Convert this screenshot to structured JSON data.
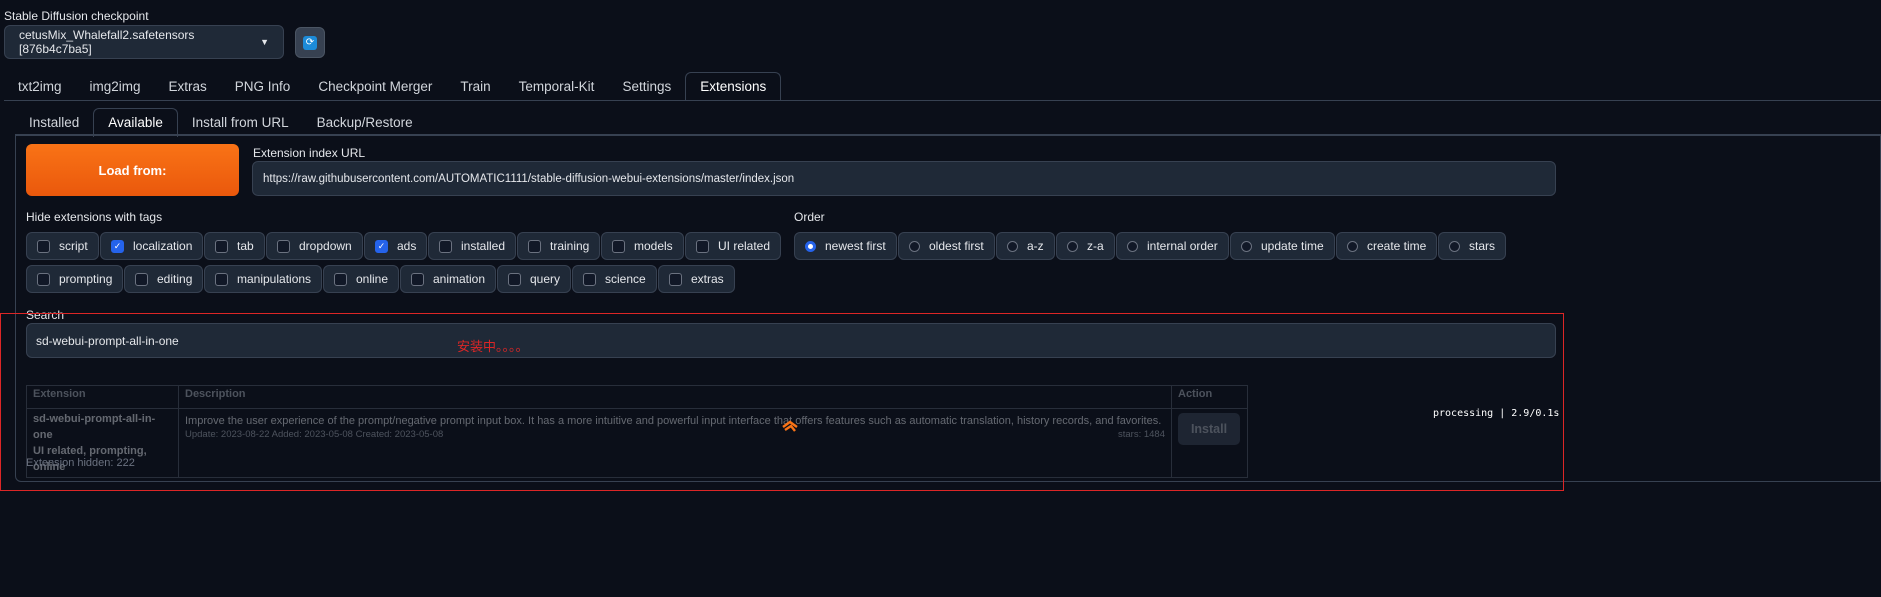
{
  "checkpoint": {
    "label": "Stable Diffusion checkpoint",
    "value": "cetusMix_Whalefall2.safetensors [876b4c7ba5]"
  },
  "main_tabs": [
    "txt2img",
    "img2img",
    "Extras",
    "PNG Info",
    "Checkpoint Merger",
    "Train",
    "Temporal-Kit",
    "Settings",
    "Extensions"
  ],
  "main_tab_active": "Extensions",
  "sub_tabs": [
    "Installed",
    "Available",
    "Install from URL",
    "Backup/Restore"
  ],
  "sub_tab_active": "Available",
  "load": {
    "button_label": "Load from:",
    "url_label": "Extension index URL",
    "url_value": "https://raw.githubusercontent.com/AUTOMATIC1111/stable-diffusion-webui-extensions/master/index.json"
  },
  "hide_tags": {
    "label": "Hide extensions with tags",
    "row1": [
      {
        "label": "script",
        "checked": false
      },
      {
        "label": "localization",
        "checked": true
      },
      {
        "label": "tab",
        "checked": false
      },
      {
        "label": "dropdown",
        "checked": false
      },
      {
        "label": "ads",
        "checked": true
      },
      {
        "label": "installed",
        "checked": false
      },
      {
        "label": "training",
        "checked": false
      },
      {
        "label": "models",
        "checked": false
      },
      {
        "label": "UI related",
        "checked": false
      }
    ],
    "row2": [
      {
        "label": "prompting",
        "checked": false
      },
      {
        "label": "editing",
        "checked": false
      },
      {
        "label": "manipulations",
        "checked": false
      },
      {
        "label": "online",
        "checked": false
      },
      {
        "label": "animation",
        "checked": false
      },
      {
        "label": "query",
        "checked": false
      },
      {
        "label": "science",
        "checked": false
      },
      {
        "label": "extras",
        "checked": false
      }
    ]
  },
  "order": {
    "label": "Order",
    "options": [
      {
        "label": "newest first",
        "selected": true
      },
      {
        "label": "oldest first",
        "selected": false
      },
      {
        "label": "a-z",
        "selected": false
      },
      {
        "label": "z-a",
        "selected": false
      },
      {
        "label": "internal order",
        "selected": false
      },
      {
        "label": "update time",
        "selected": false
      },
      {
        "label": "create time",
        "selected": false
      },
      {
        "label": "stars",
        "selected": false
      }
    ]
  },
  "search": {
    "label": "Search",
    "value": "sd-webui-prompt-all-in-one"
  },
  "overlay_note": "安装中。。。。",
  "table": {
    "headers": {
      "extension": "Extension",
      "description": "Description",
      "action": "Action"
    },
    "rows": [
      {
        "name": "sd-webui-prompt-all-in-one",
        "tags": "UI related, prompting, online",
        "description": "Improve the user experience of the prompt/negative prompt input box. It has a more intuitive and powerful input interface that offers features such as automatic translation, history records, and favorites.",
        "dates": "Update: 2023-08-22 Added: 2023-05-08 Created: 2023-05-08",
        "stars": "stars: 1484",
        "action": "Install"
      }
    ]
  },
  "processing_status": "processing | 2.9/0.1s",
  "hidden_count": "Extension hidden: 222",
  "colors": {
    "accent": "#2563eb",
    "button": "#f97316",
    "annotation": "#dc2626",
    "background": "#0b0f19"
  }
}
